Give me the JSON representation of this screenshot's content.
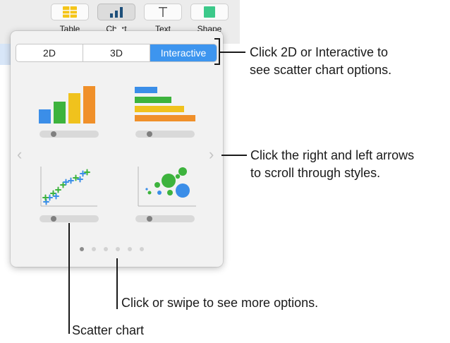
{
  "toolbar": {
    "buttons": [
      {
        "label": "Table",
        "icon": "table-icon",
        "color": "#f5c518"
      },
      {
        "label": "Chart",
        "icon": "chart-icon",
        "color": "#1d4f7a"
      },
      {
        "label": "Text",
        "icon": "text-icon",
        "glyph": "T"
      },
      {
        "label": "Shape",
        "icon": "shape-icon",
        "color": "#3cc98a"
      }
    ]
  },
  "chart_picker": {
    "segments": [
      {
        "label": "2D",
        "selected": false
      },
      {
        "label": "3D",
        "selected": false
      },
      {
        "label": "Interactive",
        "selected": true
      }
    ],
    "styles": [
      {
        "name": "column-chart-style",
        "slider_value": 0
      },
      {
        "name": "bar-chart-style",
        "slider_value": 0
      },
      {
        "name": "scatter-chart-style",
        "slider_value": 0
      },
      {
        "name": "bubble-chart-style",
        "slider_value": 0
      }
    ],
    "page_dots": 6,
    "current_page": 1
  },
  "colors": {
    "accent": "#3d95ef",
    "blue": "#3b8ee8",
    "green": "#3db33d",
    "yellow": "#f0c21d",
    "orange": "#f0902a"
  },
  "callouts": {
    "segments_line1": "Click 2D or Interactive to",
    "segments_line2": "see scatter chart options.",
    "arrows_line1": "Click the right and left arrows",
    "arrows_line2": "to scroll through styles.",
    "swipe": "Click or swipe to see more options.",
    "scatter": "Scatter chart"
  }
}
